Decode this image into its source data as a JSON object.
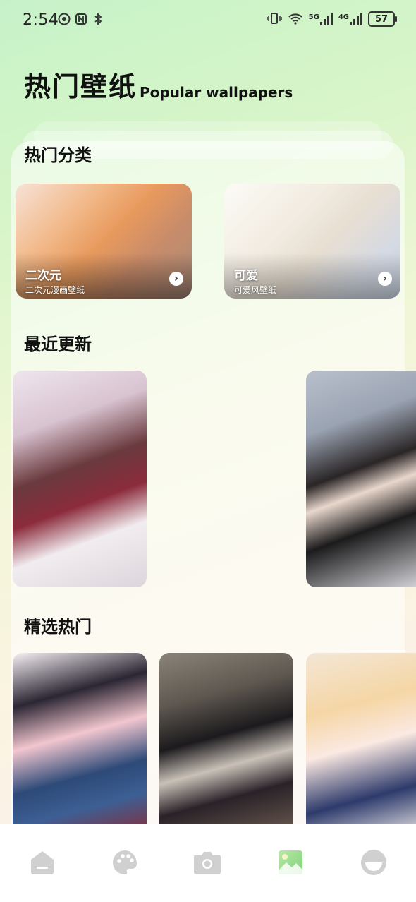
{
  "status_bar": {
    "time": "2:54",
    "network_5g": "5G",
    "network_4g": "4G",
    "battery": "57"
  },
  "header": {
    "title_cn": "热门壁纸",
    "title_en": "Popular wallpapers"
  },
  "sections": {
    "hot_categories": "热门分类",
    "recent_updates": "最近更新",
    "featured": "精选热门"
  },
  "categories": [
    {
      "name": "二次元",
      "desc": "二次元漫画壁纸"
    },
    {
      "name": "可爱",
      "desc": "可爱风壁纸"
    }
  ],
  "colors": {
    "accent_tab": "#8fd98a",
    "tab_inactive": "#d0d0d0"
  },
  "tabs": [
    {
      "icon": "home-icon"
    },
    {
      "icon": "palette-icon"
    },
    {
      "icon": "camera-icon"
    },
    {
      "icon": "wallpaper-icon"
    },
    {
      "icon": "profile-icon"
    }
  ]
}
